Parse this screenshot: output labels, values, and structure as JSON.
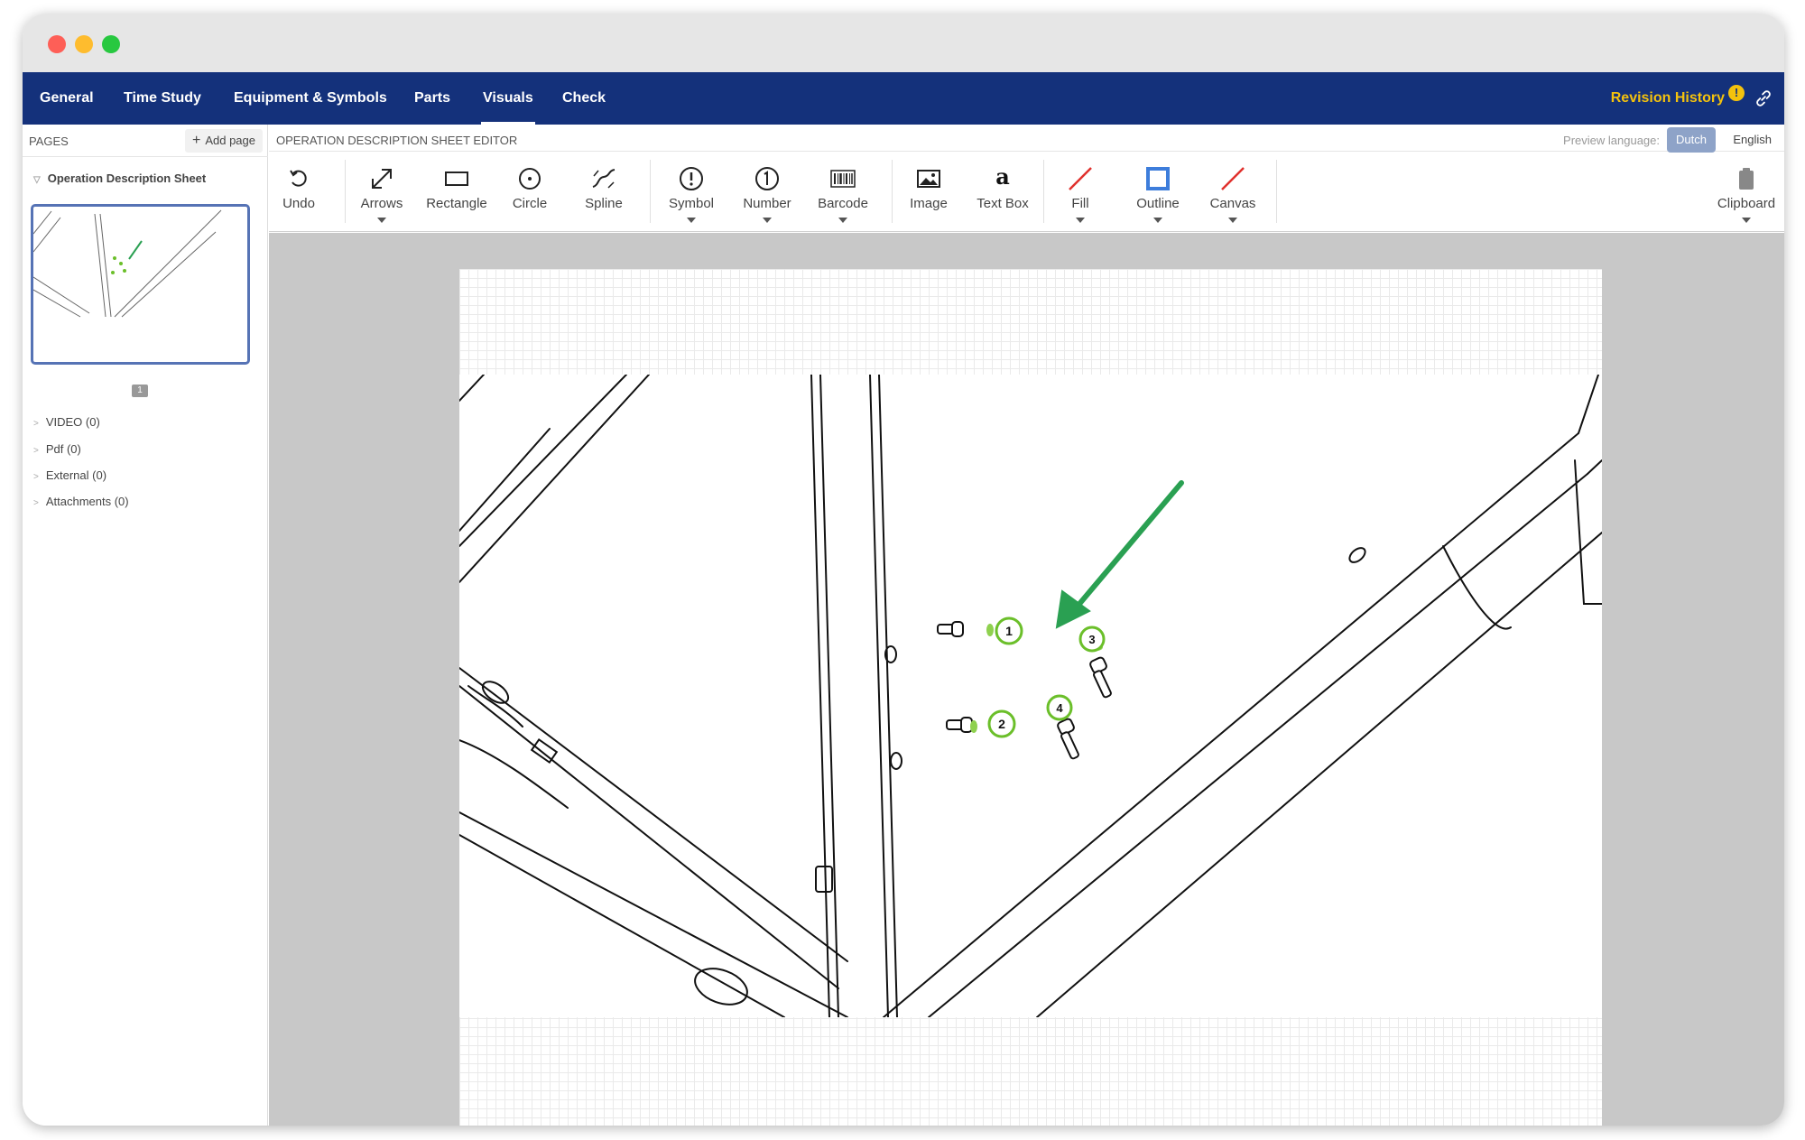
{
  "nav": {
    "tabs": [
      "General",
      "Time Study",
      "Equipment & Symbols",
      "Parts",
      "Visuals",
      "Check"
    ],
    "active": "Visuals",
    "revision_history": "Revision History",
    "revision_badge": "!"
  },
  "sidebar": {
    "pages_label": "PAGES",
    "add_page_label": "Add page",
    "sheet_label": "Operation Description Sheet",
    "page_number": "1",
    "items": [
      "VIDEO (0)",
      "Pdf (0)",
      "External (0)",
      "Attachments (0)"
    ]
  },
  "editor": {
    "title": "OPERATION DESCRIPTION SHEET EDITOR",
    "preview_language_label": "Preview language:",
    "languages": [
      "Dutch",
      "English"
    ],
    "selected_language": "Dutch"
  },
  "toolbar": {
    "tools": [
      {
        "label": "Undo",
        "icon": "undo-icon"
      },
      {
        "label": "Arrows",
        "icon": "arrows-icon"
      },
      {
        "label": "Rectangle",
        "icon": "rectangle-icon"
      },
      {
        "label": "Circle",
        "icon": "circle-icon"
      },
      {
        "label": "Spline",
        "icon": "spline-icon"
      },
      {
        "label": "Symbol",
        "icon": "symbol-icon"
      },
      {
        "label": "Number",
        "icon": "number-icon"
      },
      {
        "label": "Barcode",
        "icon": "barcode-icon"
      },
      {
        "label": "Image",
        "icon": "image-icon"
      },
      {
        "label": "Text Box",
        "icon": "text-box-icon",
        "glyph": "a"
      },
      {
        "label": "Fill",
        "icon": "fill-icon"
      },
      {
        "label": "Outline",
        "icon": "outline-icon"
      },
      {
        "label": "Canvas",
        "icon": "canvas-icon"
      },
      {
        "label": "Clipboard",
        "icon": "clipboard-icon"
      }
    ]
  },
  "canvas": {
    "callouts": [
      "1",
      "2",
      "3",
      "4"
    ],
    "colors": {
      "arrow": "#2aa052",
      "callout": "#6bbf2a",
      "outline": "#3d7ddb",
      "no_fill": "#e0302c"
    }
  }
}
